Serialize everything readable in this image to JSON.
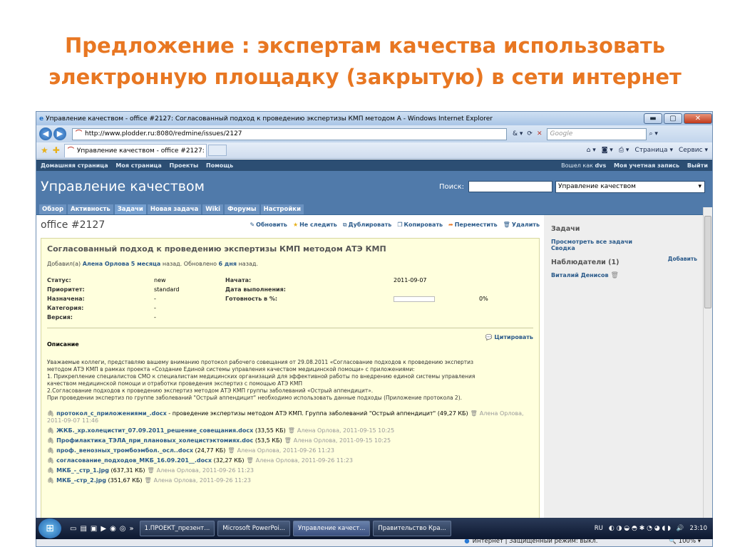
{
  "slide": {
    "title": "Предложение : экспертам качества использовать электронную площадку (закрытую) в сети интернет"
  },
  "browser": {
    "window_title": "Управление качеством - office #2127: Согласованный подход к проведению экспертизы КМП методом А - Windows Internet Explorer",
    "url": "http://www.plodder.ru:8080/redmine/issues/2127",
    "search_placeholder": "Google",
    "tab_label": "Управление качеством - office #2127: Согласов...",
    "page_menu": "Страница",
    "tools_menu": "Сервис",
    "min_btn": "▬",
    "max_btn": "▢",
    "close_btn": "✕"
  },
  "redmine": {
    "top_links": [
      "Домашняя страница",
      "Моя страница",
      "Проекты",
      "Помощь"
    ],
    "logged_in_as": "Вошел как",
    "username": "dvs",
    "account": "Моя учетная запись",
    "logout": "Выйти",
    "project_title": "Управление качеством",
    "search_label": "Поиск:",
    "project_select": "Управление качеством",
    "menu": [
      "Обзор",
      "Активность",
      "Задачи",
      "Новая задача",
      "Wiki",
      "Форумы",
      "Настройки"
    ],
    "active_menu": "Задачи"
  },
  "issue": {
    "id": "office #2127",
    "actions": [
      "Обновить",
      "Не следить",
      "Дублировать",
      "Копировать",
      "Переместить",
      "Удалить"
    ],
    "subject": "Согласованный подход к проведению экспертизы КМП методом АТЭ КМП",
    "added_prefix": "Добавил(а)",
    "author": "Алена Орлова",
    "added_ago": "5 месяца",
    "added_mid": "назад. Обновлено",
    "updated_ago": "6 дня",
    "added_suffix": "назад.",
    "labels": {
      "status": "Статус:",
      "priority": "Приоритет:",
      "assigned": "Назначена:",
      "category": "Категория:",
      "version": "Версия:",
      "start": "Начата:",
      "due": "Дата выполнения:",
      "done": "Готовность в %:"
    },
    "values": {
      "status": "new",
      "priority": "standard",
      "assigned": "-",
      "category": "-",
      "version": "-",
      "start": "2011-09-07",
      "due": "",
      "done_text": "0%"
    },
    "done_percent": 0,
    "quote_label": "Цитировать",
    "description_label": "Описание",
    "description": [
      "Уважаемые коллеги, представляю вашему вниманию протокол рабочего совещания от 29.08.2011 «Согласование подходов к проведению экспертиз",
      "методом АТЭ КМП в рамках проекта «Создание Единой системы управления качеством медицинской помощи» с приложениями:",
      "1. Прикрепление специалистов СМО к специалистам медицинских организаций для эффективной работы по внедрению единой системы управления",
      "качеством медицинской помощи и отработки проведения экспертиз с помощью АТЭ КМП",
      "2.Согласование подходов к проведению экспертиз методом АТЭ КМП группы заболеваний «Острый аппендицит».",
      "При проведении экспертиз по группе заболеваний \"Острый аппендицит\" необходимо использовать данные подходы (Приложение протокола 2)."
    ],
    "attachments": [
      {
        "name": "протокол_с_приложениями_.docx",
        "desc": " - проведение экспертизы методом АТЭ КМП. Группа заболеваний \"Острый аппендицит\" (49,27 КБ)",
        "meta": "Алена Орлова, 2011-09-07 11:46"
      },
      {
        "name": "ЖКБ._хр.холецистит_07.09.2011_решение_совещания.docx",
        "desc": " (33,55 КБ)",
        "meta": "Алена Орлова, 2011-09-15 10:25"
      },
      {
        "name": "Профилактика_ТЭЛА_при_плановых_холецистэктомиях.doc",
        "desc": " (53,5 КБ)",
        "meta": "Алена Орлова, 2011-09-15 10:25"
      },
      {
        "name": "проф._венозных_тромбоэмбол._осл..docx",
        "desc": " (24,77 КБ)",
        "meta": "Алена Орлова, 2011-09-26 11:23"
      },
      {
        "name": "согласование_подходов_МКБ_16.09.201__.docx",
        "desc": " (32,27 КБ)",
        "meta": "Алена Орлова, 2011-09-26 11:23"
      },
      {
        "name": "МКБ_-_стр_1.jpg",
        "desc": " (637,31 КБ)",
        "meta": "Алена Орлова, 2011-09-26 11:23"
      },
      {
        "name": "МКБ_-стр_2.jpg",
        "desc": " (351,67 КБ)",
        "meta": "Алена Орлова, 2011-09-26 11:23"
      }
    ]
  },
  "sidebar": {
    "tasks_title": "Задачи",
    "view_all": "Просмотреть все задачи",
    "summary": "Сводка",
    "watchers_title": "Наблюдатели (1)",
    "add": "Добавить",
    "watcher": "Виталий Денисов"
  },
  "statusbar": {
    "zone": "Интернет | Защищенный режим: выкл.",
    "zoom": "100%"
  },
  "taskbar": {
    "tasks": [
      "1.ПРОЕКТ_презент...",
      "Microsoft PowerPoi...",
      "Управление качест...",
      "Правительство Кра..."
    ],
    "lang": "RU",
    "time": "23:10"
  }
}
